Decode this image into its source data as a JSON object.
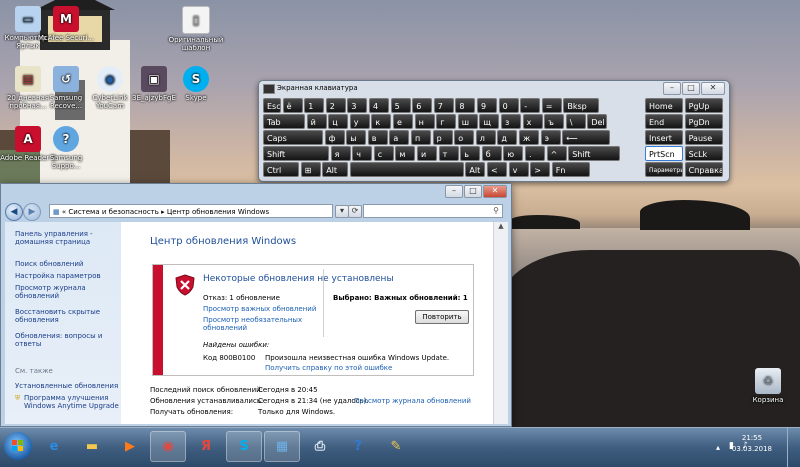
{
  "desktop": {
    "icons": [
      {
        "label": "Компьютер - Ярлык",
        "icon": "computer-icon"
      },
      {
        "label": "McAfee Securi...",
        "icon": "mcafee-icon"
      },
      {
        "label": "Оригинальный шаблон",
        "icon": "document-icon"
      },
      {
        "label": "20 дневная пробная...",
        "icon": "app-icon"
      },
      {
        "label": "Samsung Recove...",
        "icon": "samsung-recovery-icon"
      },
      {
        "label": "CyberLink YouCam",
        "icon": "webcam-icon"
      },
      {
        "label": "3E_ajzybFgE",
        "icon": "photo-icon"
      },
      {
        "label": "Skype",
        "icon": "skype-icon"
      },
      {
        "label": "Adobe Reader 9",
        "icon": "pdf-icon"
      },
      {
        "label": "Samsung Suppo...",
        "icon": "support-icon"
      }
    ],
    "recycle_bin": "Корзина"
  },
  "osk": {
    "title": "Экранная клавиатура",
    "rows": [
      [
        "Esc",
        "ё",
        "1",
        "2",
        "3",
        "4",
        "5",
        "6",
        "7",
        "8",
        "9",
        "0",
        "-",
        "=",
        "Bksp",
        "Home",
        "PgUp"
      ],
      [
        "Tab",
        "й",
        "ц",
        "у",
        "к",
        "е",
        "н",
        "г",
        "ш",
        "щ",
        "з",
        "х",
        "ъ",
        "\\",
        "Del",
        "End",
        "PgDn"
      ],
      [
        "Caps",
        "ф",
        "ы",
        "в",
        "а",
        "п",
        "р",
        "о",
        "л",
        "д",
        "ж",
        "э",
        "⟵",
        "Insert",
        "Pause"
      ],
      [
        "Shift",
        "я",
        "ч",
        "с",
        "м",
        "и",
        "т",
        "ь",
        "б",
        "ю",
        ".",
        "^",
        "Shift",
        "PrtScn",
        "ScLk"
      ],
      [
        "Ctrl",
        "⊞",
        "Alt",
        "",
        "Alt",
        "<",
        "v",
        ">",
        "Fn",
        "Параметры",
        "Справка"
      ]
    ]
  },
  "explorer": {
    "breadcrumb_root": "«",
    "breadcrumb": [
      "Система и безопасность",
      "Центр обновления Windows"
    ],
    "sidebar": {
      "home": "Панель управления - домашняя страница",
      "items": [
        "Поиск обновлений",
        "Настройка параметров",
        "Просмотр журнала обновлений",
        "Восстановить скрытые обновления",
        "Обновления: вопросы и ответы"
      ],
      "see_also_header": "См. также",
      "see_also": [
        "Установленные обновления",
        "Программа улучшения Windows Anytime Upgrade"
      ]
    },
    "title": "Центр обновления Windows",
    "panel": {
      "heading": "Некоторые обновления не установлены",
      "failed": "Отказ: 1 обновление",
      "link_important": "Просмотр важных обновлений",
      "link_optional": "Просмотр необязательных обновлений",
      "selected": "Выбрано: Важных обновлений: 1",
      "retry_button": "Повторить",
      "errors_found": "Найдены ошибки:",
      "error_code": "Код 800B0100",
      "error_text": "Произошла неизвестная ошибка Windows Update.",
      "help_link": "Получить справку по этой ошибке"
    },
    "status": [
      {
        "label": "Последний поиск обновлений:",
        "value": "Сегодня в 20:45"
      },
      {
        "label": "Обновления устанавливались:",
        "value": "Сегодня в 21:34 (не удалось).",
        "link": "Просмотр журнала обновлений"
      },
      {
        "label": "Получать обновления:",
        "value": "Только для Windows."
      }
    ]
  },
  "taskbar": {
    "apps": [
      "ie-icon",
      "folder-icon",
      "media-player-icon",
      "chrome-icon",
      "yandex-icon",
      "skype-icon",
      "control-panel-icon",
      "printer-icon",
      "help-icon",
      "tools-icon"
    ],
    "clock": {
      "time": "21:55",
      "date": "03.03.2018"
    }
  }
}
